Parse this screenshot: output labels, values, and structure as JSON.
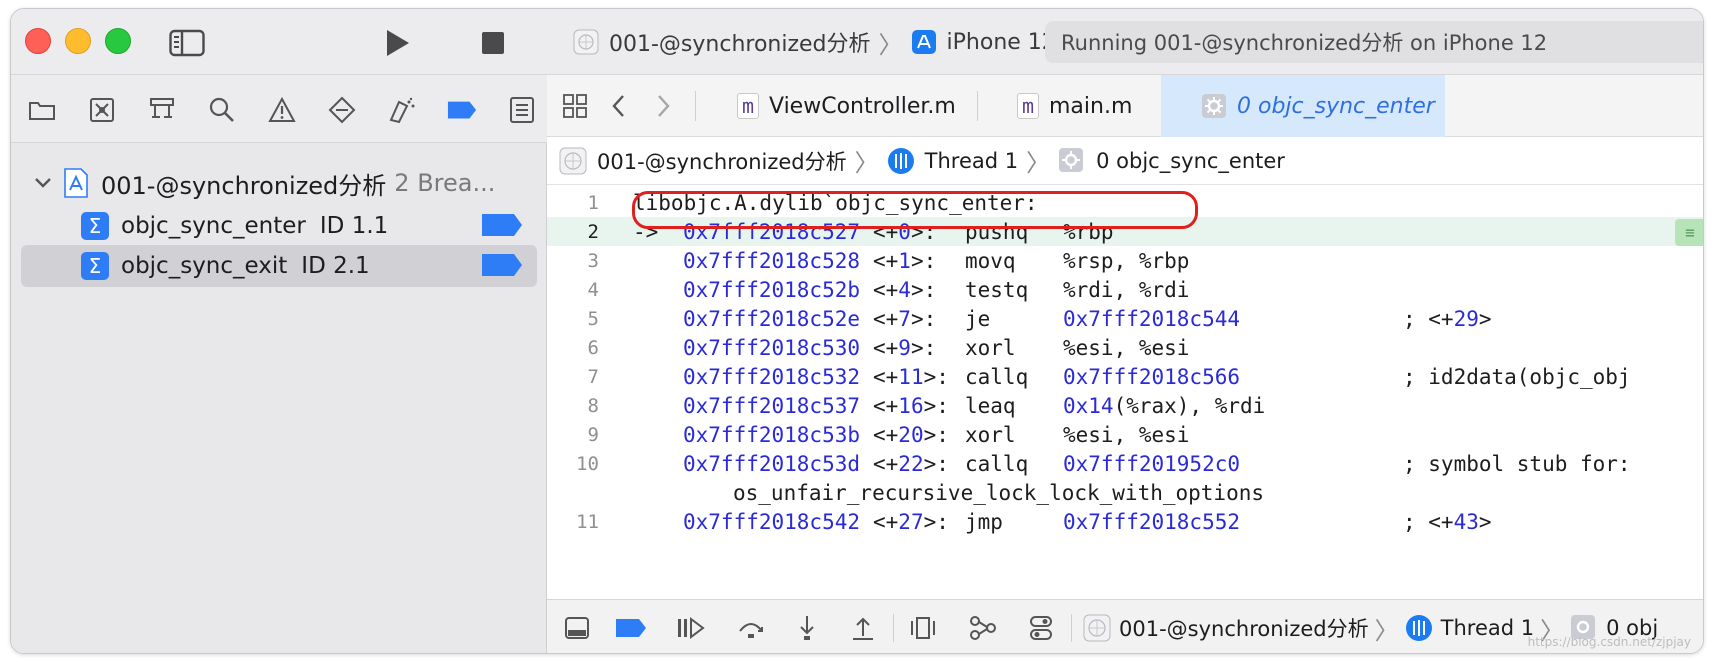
{
  "colors": {
    "accent": "#2f7df6",
    "selected_tab_bg": "#d6e8fb",
    "current_line_bg": "#e8f4ee",
    "address_blue": "#2a2ad8",
    "highlight_red": "#e0201c"
  },
  "toolbar": {
    "sidebar_icon": "sidebar-icon",
    "run_icon": "play-icon",
    "stop_icon": "stop-icon"
  },
  "navigator": {
    "icons": [
      "folder-icon",
      "source-control-icon",
      "symbol-icon",
      "search-icon",
      "warning-icon",
      "test-icon",
      "debug-icon",
      "breakpoint-icon",
      "report-icon"
    ],
    "group": {
      "title": "001-@synchronized分析",
      "subtitle": "2 Brea..."
    },
    "breakpoints": [
      {
        "name": "objc_sync_enter",
        "id": "ID 1.1"
      },
      {
        "name": "objc_sync_exit",
        "id": "ID 2.1"
      }
    ]
  },
  "titlebar": {
    "scheme": "001-@synchronized分析",
    "device": "iPhone 12",
    "status": "Running 001-@synchronized分析 on iPhone 12"
  },
  "tabs": [
    {
      "label": "ViewController.m",
      "badge": "m"
    },
    {
      "label": "main.m",
      "badge": "m"
    },
    {
      "label": "0 objc_sync_enter"
    }
  ],
  "jumpbar": {
    "project": "001-@synchronized分析",
    "thread": "Thread 1",
    "frame": "0 objc_sync_enter"
  },
  "code": {
    "header": {
      "ln": "1",
      "text": "libobjc.A.dylib`objc_sync_enter:"
    },
    "lines": [
      {
        "ln": "2",
        "arrow": "->",
        "addr": "0x7fff2018c527",
        "off_pre": "<+",
        "off_n": "0",
        "off_post": ">:",
        "op": "pushq",
        "args_pre": "%rbp",
        "args_n": "",
        "args_post": "",
        "cmt_pre": "",
        "cmt_n": "",
        "cmt_post": ""
      },
      {
        "ln": "3",
        "arrow": "",
        "addr": "0x7fff2018c528",
        "off_pre": "<+",
        "off_n": "1",
        "off_post": ">:",
        "op": "movq",
        "args_pre": "%rsp, %rbp",
        "args_n": "",
        "args_post": "",
        "cmt_pre": "",
        "cmt_n": "",
        "cmt_post": ""
      },
      {
        "ln": "4",
        "arrow": "",
        "addr": "0x7fff2018c52b",
        "off_pre": "<+",
        "off_n": "4",
        "off_post": ">:",
        "op": "testq",
        "args_pre": "%rdi, %rdi",
        "args_n": "",
        "args_post": "",
        "cmt_pre": "",
        "cmt_n": "",
        "cmt_post": ""
      },
      {
        "ln": "5",
        "arrow": "",
        "addr": "0x7fff2018c52e",
        "off_pre": "<+",
        "off_n": "7",
        "off_post": ">:",
        "op": "je",
        "args_pre": "",
        "args_n": "0x7fff2018c544",
        "args_post": "",
        "cmt_pre": "; <+",
        "cmt_n": "29",
        "cmt_post": ">"
      },
      {
        "ln": "6",
        "arrow": "",
        "addr": "0x7fff2018c530",
        "off_pre": "<+",
        "off_n": "9",
        "off_post": ">:",
        "op": "xorl",
        "args_pre": "%esi, %esi",
        "args_n": "",
        "args_post": "",
        "cmt_pre": "",
        "cmt_n": "",
        "cmt_post": ""
      },
      {
        "ln": "7",
        "arrow": "",
        "addr": "0x7fff2018c532",
        "off_pre": "<+",
        "off_n": "11",
        "off_post": ">:",
        "op": "callq",
        "args_pre": "",
        "args_n": "0x7fff2018c566",
        "args_post": "",
        "cmt_pre": "; id2data(objc_obj",
        "cmt_n": "",
        "cmt_post": ""
      },
      {
        "ln": "8",
        "arrow": "",
        "addr": "0x7fff2018c537",
        "off_pre": "<+",
        "off_n": "16",
        "off_post": ">:",
        "op": "leaq",
        "args_pre": "",
        "args_n": "0x14",
        "args_post": "(%rax), %rdi",
        "cmt_pre": "",
        "cmt_n": "",
        "cmt_post": ""
      },
      {
        "ln": "9",
        "arrow": "",
        "addr": "0x7fff2018c53b",
        "off_pre": "<+",
        "off_n": "20",
        "off_post": ">:",
        "op": "xorl",
        "args_pre": "%esi, %esi",
        "args_n": "",
        "args_post": "",
        "cmt_pre": "",
        "cmt_n": "",
        "cmt_post": ""
      },
      {
        "ln": "10",
        "arrow": "",
        "addr": "0x7fff2018c53d",
        "off_pre": "<+",
        "off_n": "22",
        "off_post": ">:",
        "op": "callq",
        "args_pre": "",
        "args_n": "0x7fff201952c0",
        "args_post": "",
        "cmt_pre": "; symbol stub for:",
        "cmt_n": "",
        "cmt_post": ""
      },
      {
        "ln": "",
        "cont": "os_unfair_recursive_lock_lock_with_options"
      },
      {
        "ln": "11",
        "arrow": "",
        "addr": "0x7fff2018c542",
        "off_pre": "<+",
        "off_n": "27",
        "off_post": ">:",
        "op": "jmp",
        "args_pre": "",
        "args_n": "0x7fff2018c552",
        "args_post": "",
        "cmt_pre": "; <+",
        "cmt_n": "43",
        "cmt_post": ">"
      }
    ]
  },
  "debugbar": {
    "icons": [
      "hide-debug-area-icon",
      "breakpoints-toggle-icon",
      "continue-icon",
      "step-over-icon",
      "step-into-icon",
      "step-out-icon",
      "view-debugger-icon",
      "memory-graph-icon",
      "environment-override-icon"
    ],
    "project": "001-@synchronized分析",
    "thread": "Thread 1",
    "frame": "0 obj"
  },
  "watermark": "https://blog.csdn.net/zjpjay"
}
